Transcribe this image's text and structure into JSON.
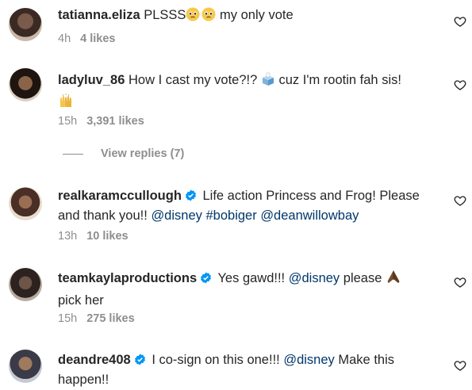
{
  "comments": [
    {
      "username": "tatianna.eliza",
      "text_parts": [
        "PLSSS",
        " my only vote"
      ],
      "time": "4h",
      "likes": "4 likes"
    },
    {
      "username": "ladyluv_86",
      "text_line1": "How I cast my vote?!?",
      "text_line1b": "cuz I'm rootin fah sis!",
      "time": "15h",
      "likes": "3,391 likes"
    },
    {
      "username": "realkaramccullough",
      "text_a": "Life action Princess and Frog! Please",
      "text_b": "and thank you!!",
      "mentions": [
        "@disney",
        "#bobiger",
        "@deanwillowbay"
      ],
      "time": "13h",
      "likes": "10 likes"
    },
    {
      "username": "teamkaylaproductions",
      "text_a": "Yes gawd!!!",
      "mention": "@disney",
      "text_b": "please",
      "text_c": "pick her",
      "time": "15h",
      "likes": "275 likes"
    },
    {
      "username": "deandre408",
      "text_a": "I co-sign on this one!!!",
      "mention": "@disney",
      "text_b": "Make this",
      "text_c": "happen!!"
    }
  ],
  "view_replies": "View replies (7)",
  "colors": {
    "text": "#262626",
    "muted": "#8e8e8e",
    "mention": "#00376b",
    "verified": "#0095f6"
  },
  "icons": [
    "heart-outline-icon",
    "verified-badge-icon",
    "pleading-face-emoji",
    "ballot-box-emoji",
    "raised-hands-emoji",
    "folded-hands-emoji"
  ]
}
